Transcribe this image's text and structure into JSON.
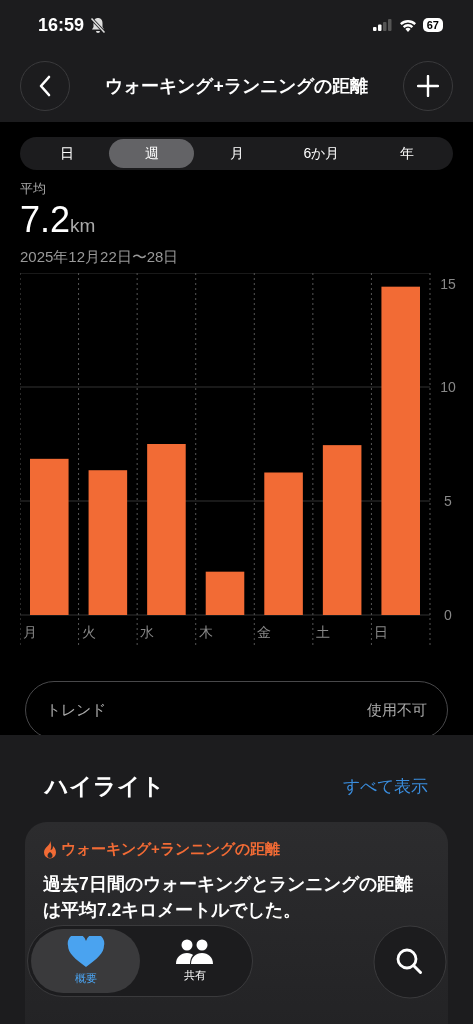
{
  "status_bar": {
    "time": "16:59",
    "battery": "67"
  },
  "nav": {
    "title": "ウォーキング+ランニングの距離"
  },
  "periods": [
    {
      "label": "日",
      "selected": false
    },
    {
      "label": "週",
      "selected": true
    },
    {
      "label": "月",
      "selected": false
    },
    {
      "label": "6か月",
      "selected": false
    },
    {
      "label": "年",
      "selected": false
    }
  ],
  "summary": {
    "label": "平均",
    "value": "7.2",
    "unit": "km",
    "range": "2025年12月22日〜28日"
  },
  "chart_data": {
    "type": "bar",
    "categories": [
      "月",
      "火",
      "水",
      "木",
      "金",
      "土",
      "日"
    ],
    "values": [
      6.85,
      6.35,
      7.5,
      1.9,
      6.25,
      7.45,
      14.4
    ],
    "ylim": [
      0,
      15
    ],
    "yticks": [
      0,
      5,
      10,
      15
    ]
  },
  "trend": {
    "label": "トレンド",
    "value": "使用不可"
  },
  "highlights": {
    "title": "ハイライト",
    "link": "すべて表示",
    "card": {
      "title": "ウォーキング+ランニングの距離",
      "body": "過去7日間のウォーキングとランニングの距離は平均7.2キロメートルでした。"
    }
  },
  "tab_bar": [
    {
      "label": "概要",
      "selected": true,
      "kind": "heart"
    },
    {
      "label": "共有",
      "selected": false,
      "kind": "people"
    }
  ]
}
